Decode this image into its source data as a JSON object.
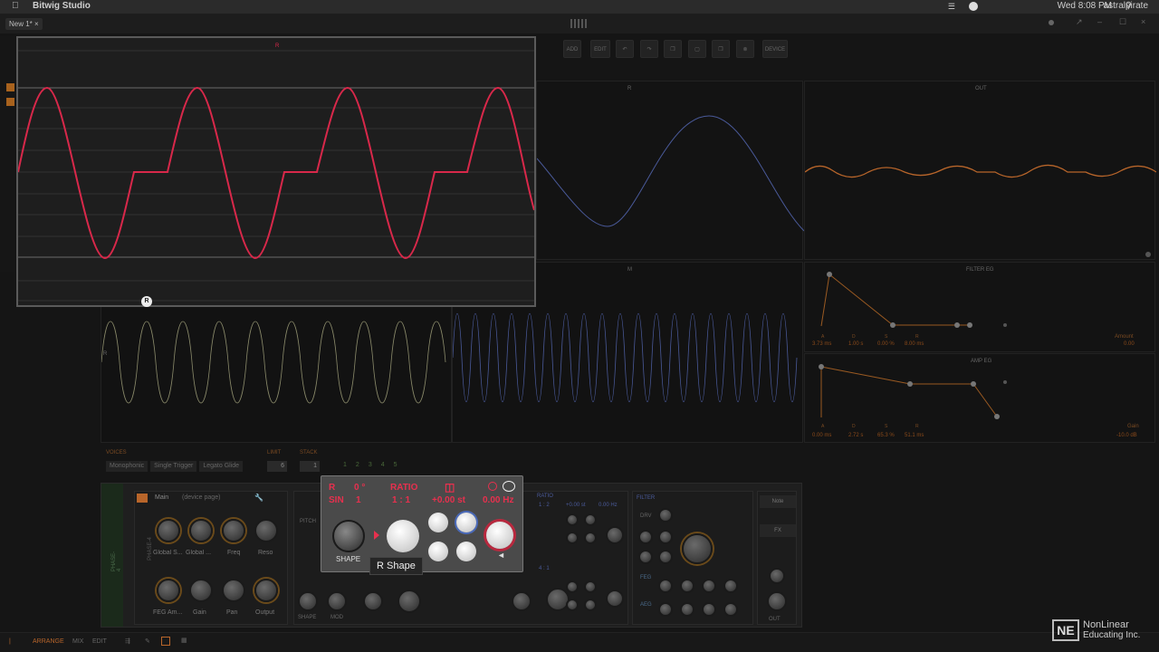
{
  "menubar": {
    "app_name": "Bitwig Studio",
    "clock": "Wed 8:08 PM",
    "user": "astralpirate"
  },
  "window": {
    "project_tab": "New 1*"
  },
  "toolbar": {
    "add_label": "ADD",
    "edit_label": "EDIT",
    "device_label": "DEVICE"
  },
  "scopes": {
    "top_middle_marker": "R",
    "out_label": "OUT",
    "middle_marker": "M",
    "left_marker": "R"
  },
  "zoom": {
    "top_marker": "R",
    "bottom_badge": "R"
  },
  "filter_eg": {
    "title": "FILTER EG",
    "labels": [
      "A",
      "D",
      "S",
      "R"
    ],
    "values": [
      "3.73 ms",
      "1.00 s",
      "0.00 %",
      "8.00 ms"
    ],
    "amount_label": "Amount",
    "amount_value": "0.00"
  },
  "amp_eg": {
    "title": "AMP EG",
    "labels": [
      "A",
      "D",
      "S",
      "R"
    ],
    "values": [
      "0.00 ms",
      "2.72 s",
      "65.3 %",
      "51.1 ms"
    ],
    "gain_label": "Gain",
    "gain_value": "-10.0 dB"
  },
  "voices": {
    "voices_label": "VOICES",
    "mode_buttons": [
      "Monophonic",
      "Single Trigger",
      "Legato Glide"
    ],
    "limit_label": "LIMIT",
    "limit_value": "6",
    "stack_label": "STACK",
    "stack_value": "1",
    "stack_numbers": [
      "1",
      "2",
      "3",
      "4",
      "5"
    ]
  },
  "device": {
    "track_label": "PHASE-4",
    "chain_label": "Main",
    "chain_sub": "(device page)",
    "phase_label": "PHASE-4",
    "macro_knobs_top": [
      "Global S...",
      "Global ...",
      "Freq",
      "Reso"
    ],
    "macro_knobs_bottom": [
      "FEG Am...",
      "Gain",
      "Pan",
      "Output"
    ],
    "pitch_label": "PITCH",
    "shape_label": "SHAPE",
    "mod_label": "MOD",
    "ratio_label": "RATIO",
    "ratio_values": [
      "1 : 2",
      "4 : 1"
    ],
    "semitones": "+0.00 st",
    "hz": "0.00 Hz",
    "filter_label": "FILTER",
    "drv_label": "DRV",
    "feg_label": "FEG",
    "aeg_label": "AEG",
    "out_label": "OUT",
    "note_button": "Note",
    "fx_button": "FX"
  },
  "popup": {
    "osc_name": "R",
    "phase": "0 °",
    "ratio_label": "RATIO",
    "wave": "SIN",
    "wave_index": "1",
    "ratio_value": "1 : 1",
    "semitones": "+0.00 st",
    "hz": "0.00 Hz",
    "shape_label": "SHAPE",
    "tooltip": "R Shape"
  },
  "footer": {
    "arrange": "ARRANGE",
    "mix": "MIX",
    "edit": "EDIT"
  },
  "watermark": {
    "line1": "NonLinear",
    "line2": "Educating Inc.",
    "mark": "NE"
  },
  "colors": {
    "accent_red": "#e8304e",
    "wave_blue": "#4a5a9a",
    "wave_orange": "#b8652a",
    "zoom_wave": "#d8284a"
  }
}
